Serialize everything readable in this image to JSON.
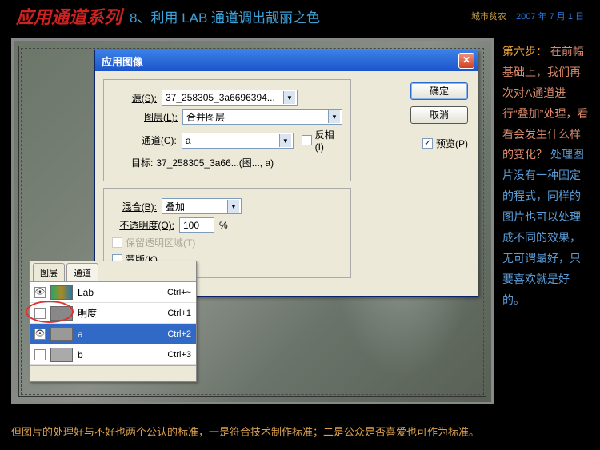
{
  "header": {
    "series": "应用通道系列",
    "title": "8、利用 LAB 通道调出靓丽之色",
    "tag": "城市贫农",
    "date": "2007 年 7 月 1 日"
  },
  "dialog": {
    "title": "应用图像",
    "src_label": "源(S):",
    "src_value": "37_258305_3a6696394...",
    "layer_label": "图层(L):",
    "layer_value": "合并图层",
    "channel_label": "通道(C):",
    "channel_value": "a",
    "invert_label": "反相(I)",
    "target_label": "目标:",
    "target_value": "37_258305_3a66...(图..., a)",
    "blend_label": "混合(B):",
    "blend_value": "叠加",
    "opacity_label": "不透明度(O):",
    "opacity_value": "100",
    "opacity_unit": "%",
    "preserve_label": "保留透明区域(T)",
    "mask_label": "蒙版(K)...",
    "ok": "确定",
    "cancel": "取消",
    "preview": "预览(P)"
  },
  "panel": {
    "tab1": "图层",
    "tab2": "通道",
    "rows": [
      {
        "name": "Lab",
        "shortcut": "Ctrl+~",
        "eye": true,
        "thumb": "thumb-lab",
        "sel": false
      },
      {
        "name": "明度",
        "shortcut": "Ctrl+1",
        "eye": false,
        "thumb": "thumb-l",
        "sel": false
      },
      {
        "name": "a",
        "shortcut": "Ctrl+2",
        "eye": true,
        "thumb": "thumb-a",
        "sel": true
      },
      {
        "name": "b",
        "shortcut": "Ctrl+3",
        "eye": false,
        "thumb": "thumb-b",
        "sel": false
      }
    ]
  },
  "sidebar": {
    "step": "第六步：",
    "p1": "在前幅基础上，我们再次对A通道进行“叠加”处理，看看会发生什么样的变化？",
    "p2": "处理图片没有一种固定的程式，同样的图片也可以处理成不同的效果，无可谓最好，只要喜欢就是好的。"
  },
  "footer": "但图片的处理好与不好也两个公认的标准，一是符合技术制作标准；二是公众是否喜爱也可作为标准。"
}
